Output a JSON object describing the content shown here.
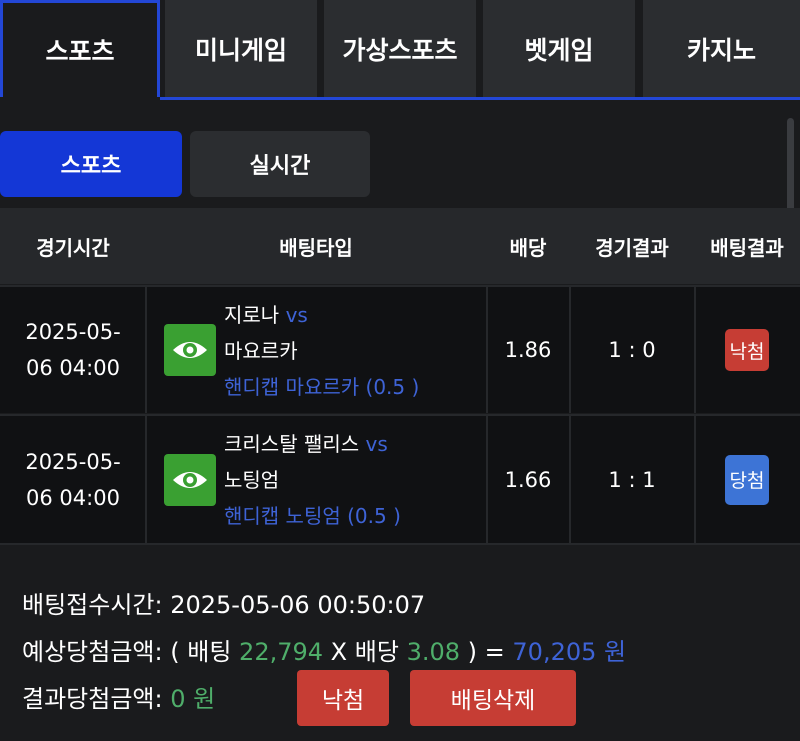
{
  "tabs": [
    {
      "label": "스포츠",
      "active": true
    },
    {
      "label": "미니게임",
      "active": false
    },
    {
      "label": "가상스포츠",
      "active": false
    },
    {
      "label": "벳게임",
      "active": false
    },
    {
      "label": "카지노",
      "active": false
    }
  ],
  "subtabs": {
    "sports": "스포츠",
    "live": "실시간"
  },
  "table": {
    "headers": {
      "time": "경기시간",
      "bet_type": "배팅타입",
      "odds": "배당",
      "score": "경기결과",
      "result": "배팅결과"
    },
    "rows": [
      {
        "time_line1": "2025-05-",
        "time_line2": "06 04:00",
        "home": "지로나",
        "vs": "vs",
        "away": "마요르카",
        "pick": "핸디캡 마요르카 (0.5 )",
        "odds": "1.86",
        "score": "1 : 0",
        "result": "낙첨",
        "result_type": "lose"
      },
      {
        "time_line1": "2025-05-",
        "time_line2": "06 04:00",
        "home": "크리스탈 팰리스",
        "vs": "vs",
        "away": "노팅엄",
        "pick": "핸디캡 노팅엄 (0.5 )",
        "odds": "1.66",
        "score": "1 : 1",
        "result": "당첨",
        "result_type": "win"
      }
    ]
  },
  "summary": {
    "received_label": "배팅접수시간:",
    "received_value": "2025-05-06 00:50:07",
    "expected_label": "예상당첨금액:",
    "open_paren": "(",
    "bet_label": "배팅",
    "bet_amount": "22,794",
    "times": "X",
    "odds_label": "배당",
    "total_odds": "3.08",
    "close_eq": ") =",
    "expected_amount": "70,205 원",
    "result_label": "결과당첨금액:",
    "result_amount": "0 원",
    "status_button": "낙첨",
    "delete_button": "배팅삭제"
  },
  "colors": {
    "accent_blue": "#1437d6",
    "tab_border": "#2347d6",
    "lose_red": "#c63d34",
    "win_blue": "#3d74d6",
    "eye_green": "#3aa032",
    "amount_green": "#4fae6a"
  }
}
